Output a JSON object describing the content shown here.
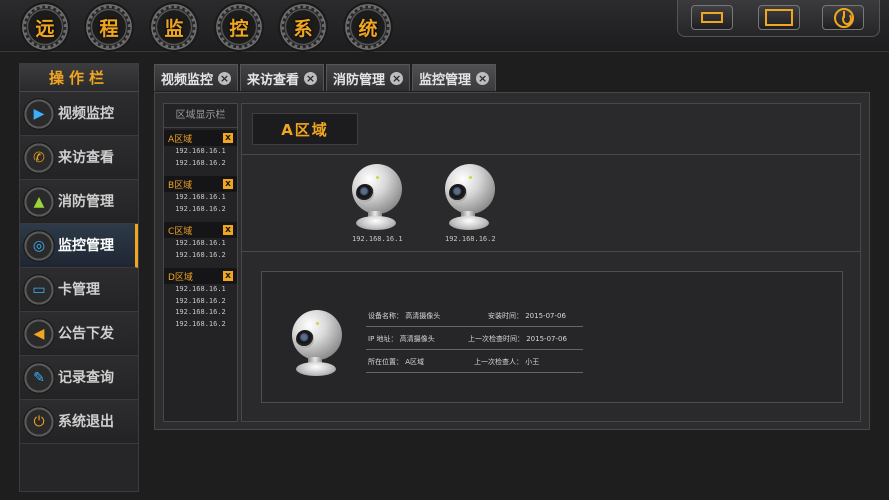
{
  "header": {
    "title_chars": [
      "远",
      "程",
      "监",
      "控",
      "系",
      "统"
    ],
    "window_buttons": [
      {
        "name": "minimize",
        "icon": "minimize-icon"
      },
      {
        "name": "maximize",
        "icon": "maximize-icon"
      },
      {
        "name": "power",
        "icon": "power-icon"
      }
    ]
  },
  "sidebar": {
    "title": "操作栏",
    "items": [
      {
        "label": "视频监控",
        "icon": "play-icon",
        "active": false
      },
      {
        "label": "来访查看",
        "icon": "phone-icon",
        "active": false
      },
      {
        "label": "消防管理",
        "icon": "cone-icon",
        "active": false
      },
      {
        "label": "监控管理",
        "icon": "target-icon",
        "active": true
      },
      {
        "label": "卡管理",
        "icon": "card-icon",
        "active": false
      },
      {
        "label": "公告下发",
        "icon": "megaphone-icon",
        "active": false
      },
      {
        "label": "记录查询",
        "icon": "edit-icon",
        "active": false
      },
      {
        "label": "系统退出",
        "icon": "exit-icon",
        "active": false
      }
    ]
  },
  "tabs": [
    {
      "label": "视频监控",
      "active": false
    },
    {
      "label": "来访查看",
      "active": false
    },
    {
      "label": "消防管理",
      "active": false
    },
    {
      "label": "监控管理",
      "active": true
    }
  ],
  "region_panel": {
    "title": "区域显示栏",
    "zones": [
      {
        "name": "A区域",
        "close": "x",
        "ips": [
          "192.168.16.1",
          "192.168.16.2"
        ]
      },
      {
        "name": "B区域",
        "close": "x",
        "ips": [
          "192.168.16.1",
          "192.168.16.2"
        ]
      },
      {
        "name": "C区域",
        "close": "x",
        "ips": [
          "192.168.16.1",
          "192.168.16.2"
        ]
      },
      {
        "name": "D区域",
        "close": "x",
        "ips": [
          "192.168.16.1",
          "192.168.16.2",
          "192.168.16.2",
          "192.168.16.2"
        ]
      }
    ]
  },
  "content": {
    "area_title": "A区域",
    "cameras": [
      {
        "ip": "192.168.16.1"
      },
      {
        "ip": "192.168.16.2"
      }
    ],
    "detail": {
      "rows": [
        {
          "left": "设备名称：  高清摄像头",
          "right": "安装时间：  2015-07-06"
        },
        {
          "left": "IP 地址：  高清摄像头",
          "right": "上一次检查时间：  2015-07-06"
        },
        {
          "left": "所在位置：  A区域",
          "right": "上一次检查人：  小王"
        }
      ]
    }
  },
  "colors": {
    "accent": "#f2a620",
    "background": "#1e1e1f",
    "panel": "#2d2d2f"
  }
}
